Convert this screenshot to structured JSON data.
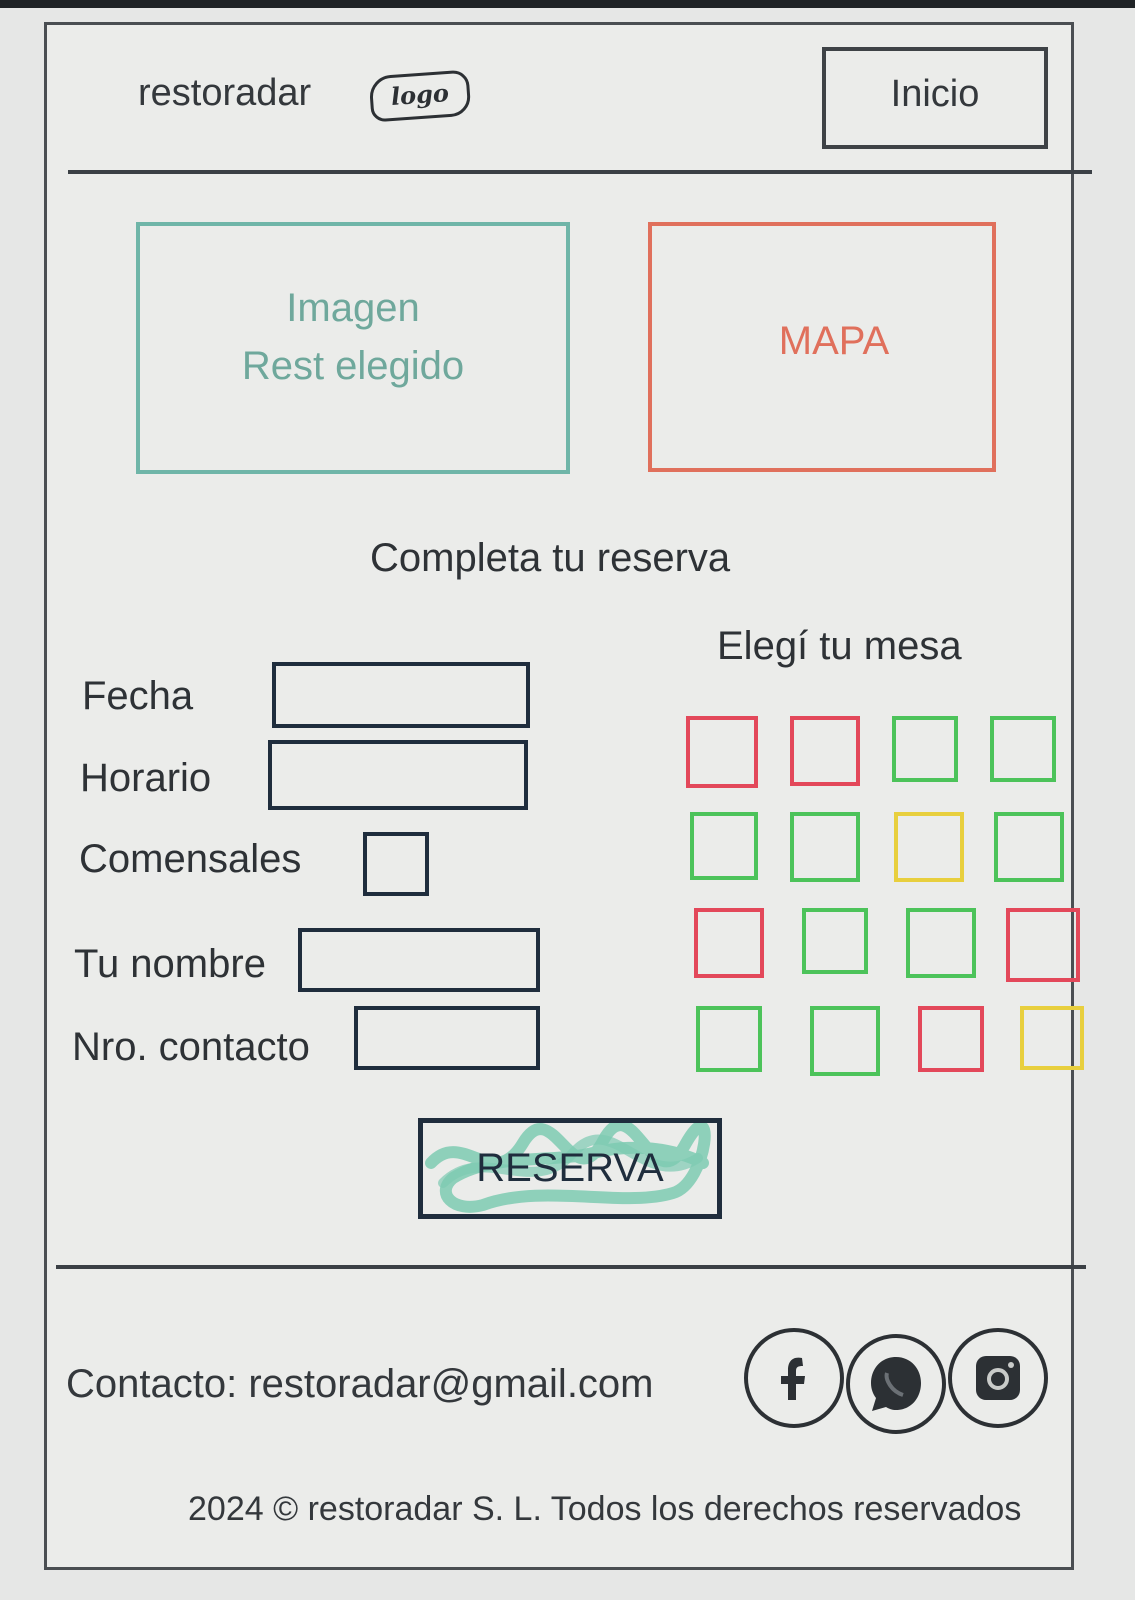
{
  "header": {
    "brand": "restoradar",
    "logo_text": "logo",
    "nav_button": "Inicio"
  },
  "media": {
    "image_line1": "Imagen",
    "image_line2": "Rest elegido",
    "map_label": "MAPA"
  },
  "form": {
    "title": "Completa tu reserva",
    "fields": [
      {
        "label": "Fecha",
        "value": ""
      },
      {
        "label": "Horario",
        "value": ""
      },
      {
        "label": "Comensales",
        "value": ""
      },
      {
        "label": "Tu nombre",
        "value": ""
      },
      {
        "label": "Nro. contacto",
        "value": ""
      }
    ],
    "submit_label": "RESERVA"
  },
  "tables": {
    "title": "Elegí tu mesa",
    "status_colors": {
      "red": "#e3485a",
      "green": "#4cc35a",
      "yellow": "#e8cf3e"
    },
    "rows": [
      [
        "red",
        "red",
        "green",
        "green"
      ],
      [
        "green",
        "green",
        "yellow",
        "green"
      ],
      [
        "red",
        "green",
        "green",
        "red"
      ],
      [
        "green",
        "green",
        "red",
        "yellow"
      ]
    ]
  },
  "footer": {
    "contact": "Contacto: restoradar@gmail.com",
    "social_icons": [
      "facebook-icon",
      "whatsapp-icon",
      "instagram-icon"
    ],
    "copyright": "2024 © restoradar S. L. Todos los derechos reservados"
  },
  "colors": {
    "frame": "#4a4e52",
    "image_box": "#6fb5a8",
    "map_box": "#e0705c",
    "input_border": "#1f2d3d",
    "button_scribble": "#7ecbb2"
  }
}
